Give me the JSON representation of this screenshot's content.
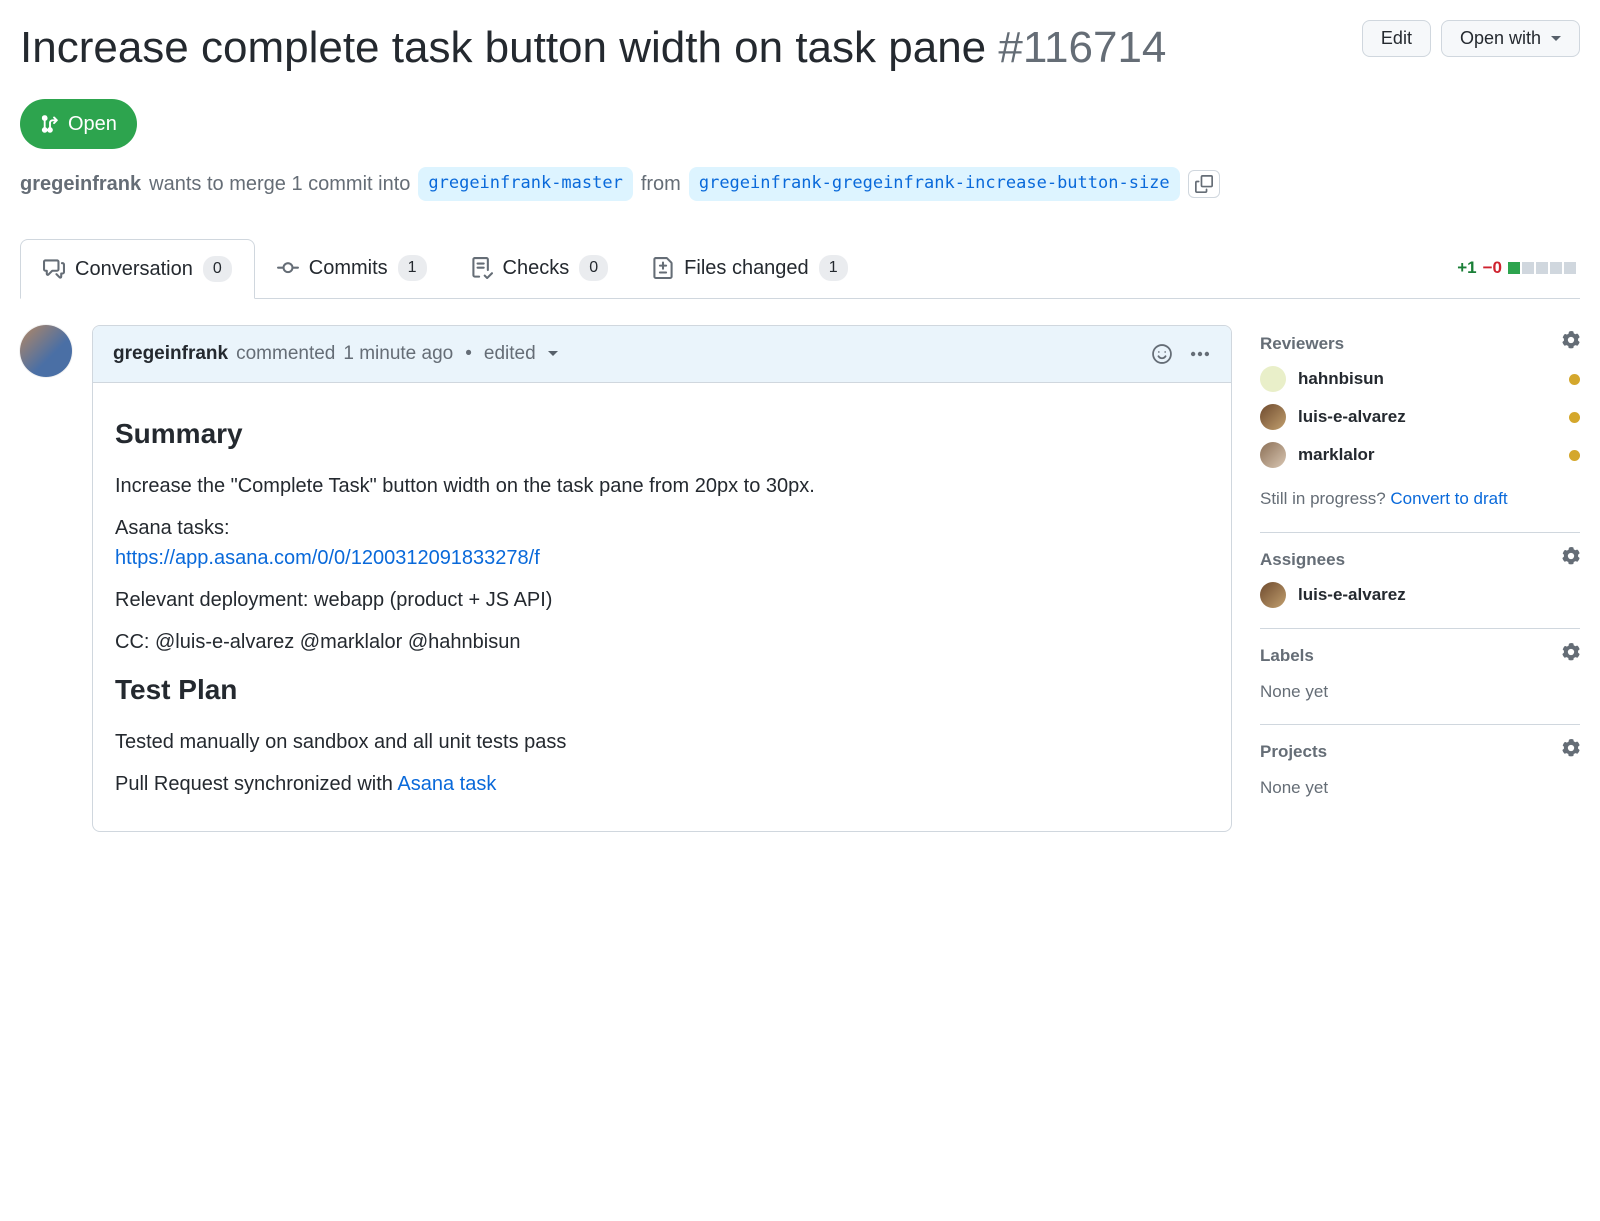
{
  "header": {
    "title": "Increase complete task button width on task pane ",
    "issue_number": "#116714",
    "edit": "Edit",
    "open_with": "Open with"
  },
  "state": {
    "label": "Open"
  },
  "merge": {
    "author": "gregeinfrank",
    "text_pre": "wants to merge 1 commit into",
    "base": "gregeinfrank-master",
    "text_mid": "from",
    "head": "gregeinfrank-gregeinfrank-increase-button-size"
  },
  "tabs": {
    "conversation": {
      "label": "Conversation",
      "count": "0"
    },
    "commits": {
      "label": "Commits",
      "count": "1"
    },
    "checks": {
      "label": "Checks",
      "count": "0"
    },
    "files": {
      "label": "Files changed",
      "count": "1"
    }
  },
  "diffstat": {
    "additions": "+1",
    "deletions": "−0"
  },
  "comment": {
    "author": "gregeinfrank",
    "commented": "commented",
    "time": "1 minute ago",
    "edited": "edited",
    "summary_h": "Summary",
    "p1": "Increase the \"Complete Task\" button width on the task pane from 20px to 30px.",
    "p2_label": "Asana tasks:",
    "asana_url": "https://app.asana.com/0/0/1200312091833278/f",
    "p3": "Relevant deployment: webapp (product + JS API)",
    "p4": "CC: @luis-e-alvarez @marklalor @hahnbisun",
    "testplan_h": "Test Plan",
    "p5": "Tested manually on sandbox and all unit tests pass",
    "p6_pre": "Pull Request synchronized with ",
    "p6_link": "Asana task"
  },
  "sidebar": {
    "reviewers_h": "Reviewers",
    "reviewers": [
      {
        "name": "hahnbisun"
      },
      {
        "name": "luis-e-alvarez"
      },
      {
        "name": "marklalor"
      }
    ],
    "draft_text": "Still in progress? ",
    "draft_link": "Convert to draft",
    "assignees_h": "Assignees",
    "assignees": [
      {
        "name": "luis-e-alvarez"
      }
    ],
    "labels_h": "Labels",
    "labels_none": "None yet",
    "projects_h": "Projects",
    "projects_none": "None yet"
  }
}
